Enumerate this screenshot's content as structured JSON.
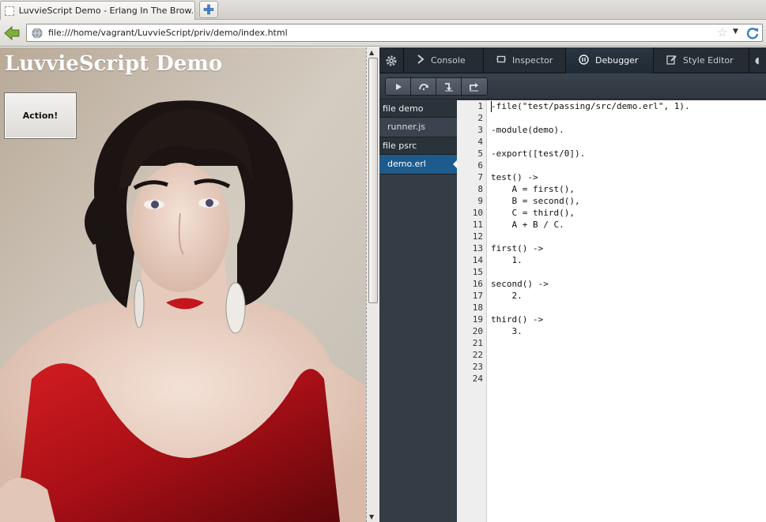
{
  "browser": {
    "tab_title": "LuvvieScript Demo - Erlang In The Brow...",
    "url": "file:///home/vagrant/LuvvieScript/priv/demo/index.html"
  },
  "page": {
    "title": "LuvvieScript Demo",
    "action_button": "Action!"
  },
  "devtools": {
    "tabs": [
      {
        "label": "Console",
        "icon": "chevron-right-icon"
      },
      {
        "label": "Inspector",
        "icon": "inspector-icon"
      },
      {
        "label": "Debugger",
        "icon": "pause-icon",
        "selected": true
      },
      {
        "label": "Style Editor",
        "icon": "edit-icon"
      }
    ],
    "debugger_buttons": [
      "resume-icon",
      "step-over-icon",
      "step-in-icon",
      "step-out-icon"
    ],
    "sources": [
      {
        "type": "group",
        "label": "file demo"
      },
      {
        "type": "item",
        "label": "runner.js"
      },
      {
        "type": "group",
        "label": "file psrc"
      },
      {
        "type": "item",
        "label": "demo.erl",
        "selected": true
      }
    ],
    "code_lines": [
      "-file(\"test/passing/src/demo.erl\", 1).",
      "",
      "-module(demo).",
      "",
      "-export([test/0]).",
      "",
      "test() ->",
      "    A = first(),",
      "    B = second(),",
      "    C = third(),",
      "    A + B / C.",
      "",
      "first() ->",
      "    1.",
      "",
      "second() ->",
      "    2.",
      "",
      "third() ->",
      "    3.",
      "",
      "",
      "",
      ""
    ],
    "line_numbers": [
      "1",
      "2",
      "3",
      "4",
      "5",
      "6",
      "7",
      "8",
      "9",
      "10",
      "11",
      "12",
      "13",
      "14",
      "15",
      "16",
      "17",
      "18",
      "19",
      "20",
      "21",
      "22",
      "23",
      "24"
    ]
  },
  "colors": {
    "devtools_bg": "#343c45",
    "selected_source": "#1d5b8c",
    "dress_red": "#b3121a"
  }
}
